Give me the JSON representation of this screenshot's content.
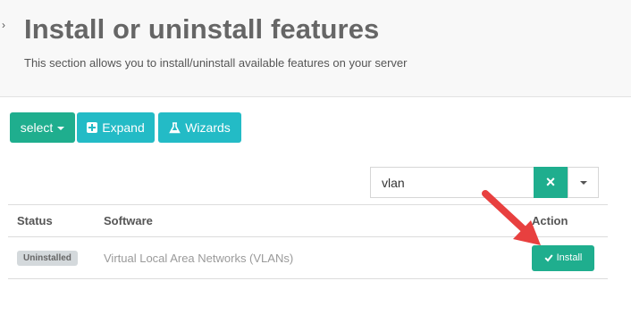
{
  "header": {
    "title": "Install or uninstall features",
    "subtitle": "This section allows you to install/uninstall available features on your server"
  },
  "toolbar": {
    "select_label": "select",
    "expand_label": "Expand",
    "wizards_label": "Wizards"
  },
  "search": {
    "value": "vlan",
    "clear_icon": "×"
  },
  "table": {
    "columns": [
      "Status",
      "Software",
      "Action"
    ],
    "rows": [
      {
        "status": "Uninstalled",
        "software": "Virtual Local Area Networks (VLANs)",
        "action_label": "Install"
      }
    ]
  },
  "colors": {
    "accent_green": "#1fae8e",
    "accent_teal": "#23bbc6",
    "annotation_red": "#e8403f"
  }
}
